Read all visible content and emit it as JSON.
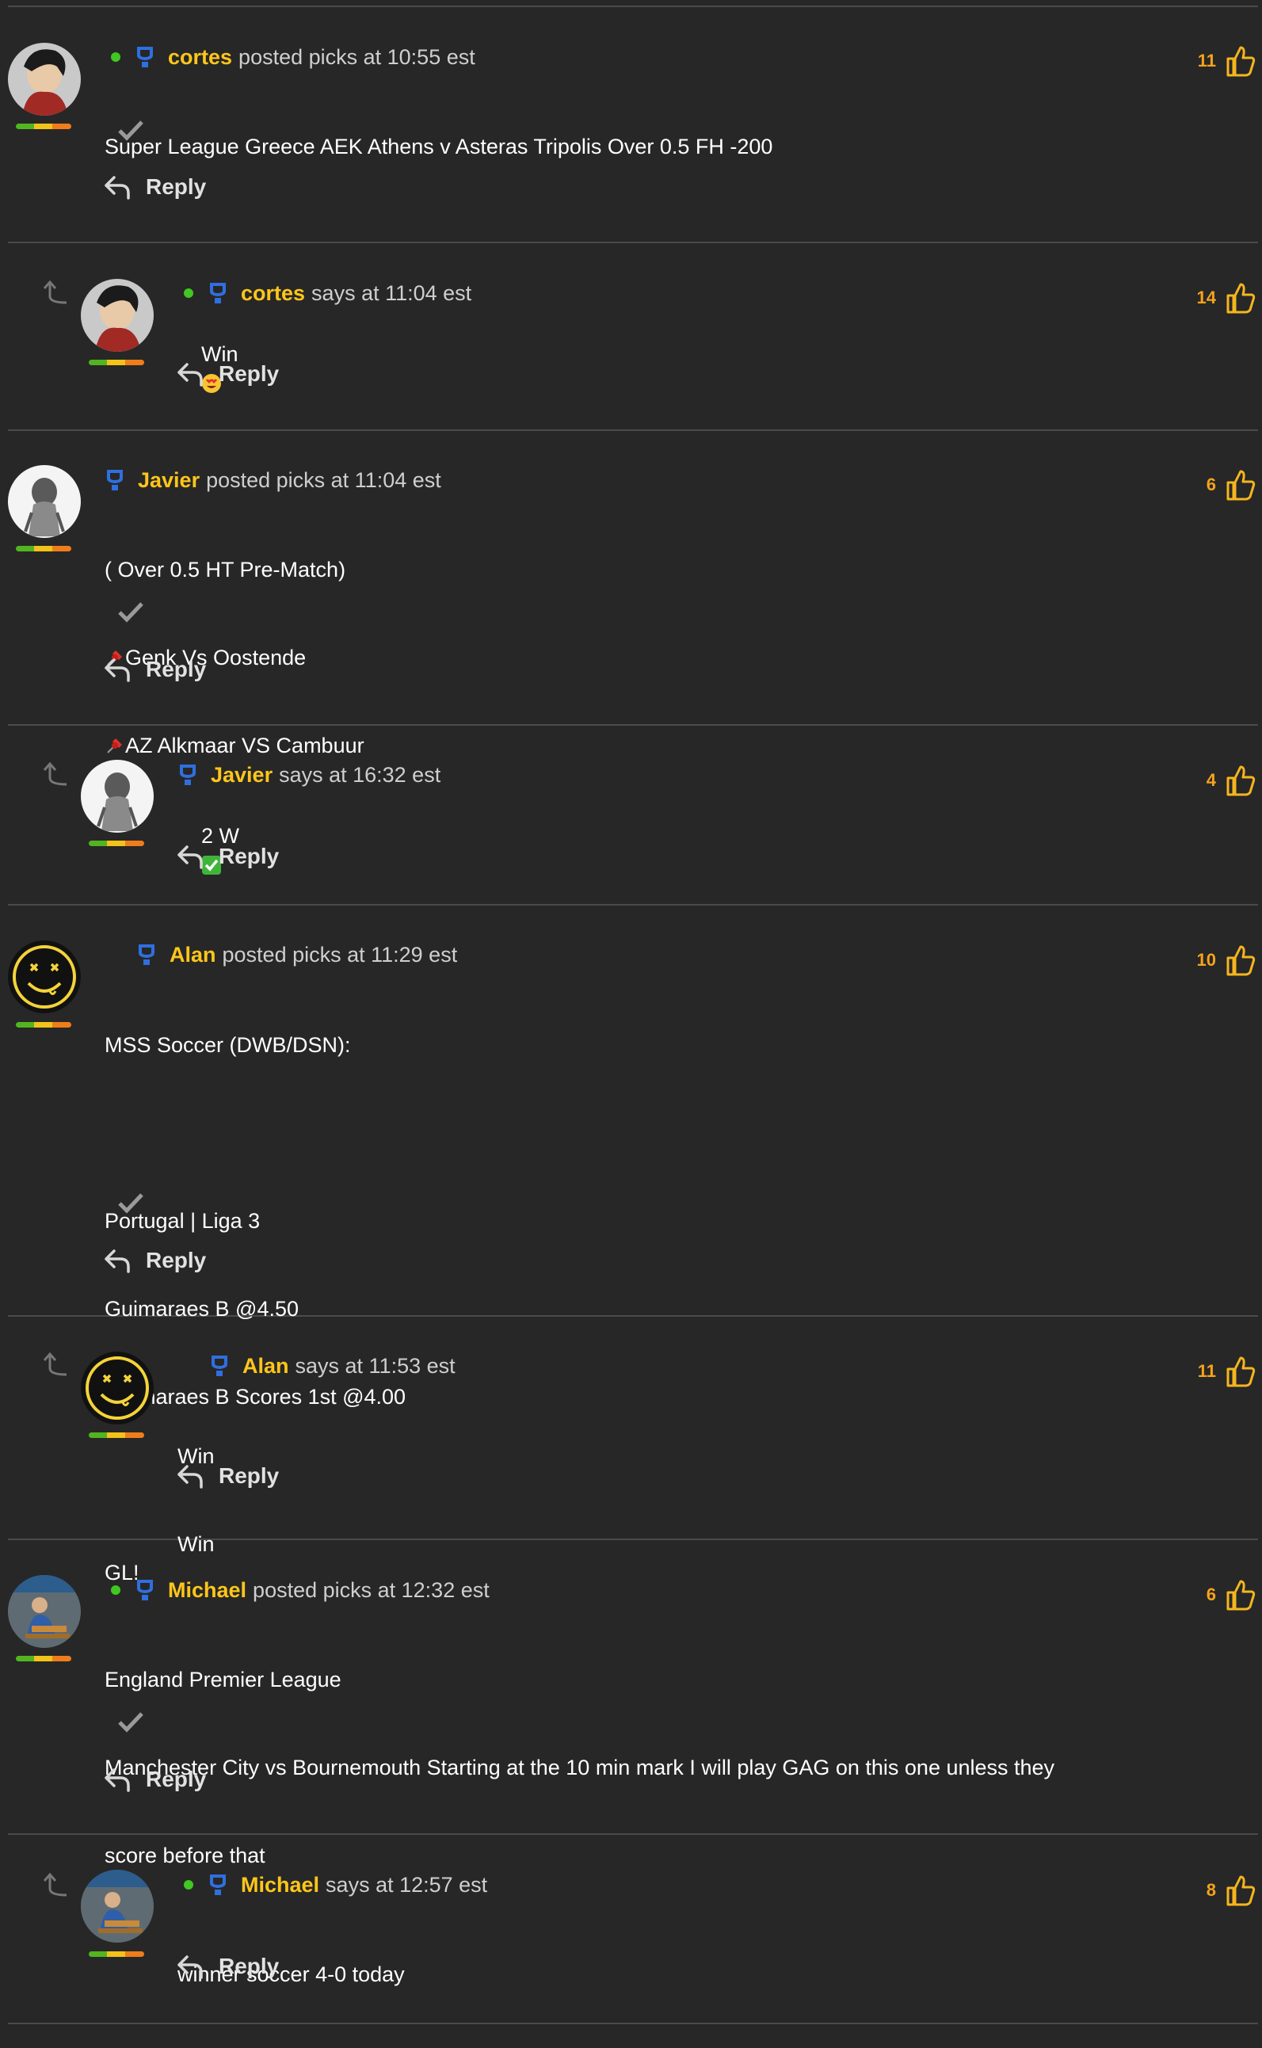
{
  "posts": [
    {
      "user": "cortes",
      "meta": "posted picks at 10:55 est",
      "likes": "11",
      "lines": [
        "Super League Greece AEK Athens v Asteras Tripolis Over 0.5 FH -200"
      ],
      "reply_label": "Reply"
    },
    {
      "user": "cortes",
      "meta": "says at 11:04 est",
      "likes": "14",
      "text": "Win",
      "emoji": "heart-eyes-emoji",
      "reply_label": "Reply"
    },
    {
      "user": "Javier",
      "meta": "posted picks at 11:04 est",
      "likes": "6",
      "lines": [
        "( Over 0.5 HT Pre-Match)",
        "Genk Vs Oostende",
        "AZ Alkmaar VS Cambuur"
      ],
      "pin_icon": "pushpin-icon",
      "reply_label": "Reply"
    },
    {
      "user": "Javier",
      "meta": "says at 16:32 est",
      "likes": "4",
      "text": "2 W",
      "emoji": "check-mark-button-emoji",
      "reply_label": "Reply"
    },
    {
      "user": "Alan",
      "meta": "posted picks at 11:29 est",
      "likes": "10",
      "lines": [
        "MSS Soccer (DWB/DSN):",
        "",
        "Portugal | Liga 3",
        "Guimaraes B @4.50",
        "Guimaraes B Scores 1st @4.00",
        "",
        "GL!"
      ],
      "reply_label": "Reply"
    },
    {
      "user": "Alan",
      "meta": "says at 11:53 est",
      "likes": "11",
      "lines": [
        "Win",
        "Win"
      ],
      "reply_label": "Reply"
    },
    {
      "user": "Michael",
      "meta": "posted picks at 12:32 est",
      "likes": "6",
      "lines": [
        "England Premier League",
        "Manchester City vs Bournemouth Starting at the 10 min mark I will play GAG on this one unless they",
        "score before that"
      ],
      "reply_label": "Reply"
    },
    {
      "user": "Michael",
      "meta": "says at 12:57 est",
      "likes": "8",
      "lines": [
        "winner soccer 4-0 today"
      ],
      "reply_label": "Reply"
    }
  ],
  "colors": {
    "background": "#272727",
    "username": "#ffc61a",
    "like_count": "#f5a31c",
    "online": "#41c721",
    "badge": "#2f6fe0"
  }
}
